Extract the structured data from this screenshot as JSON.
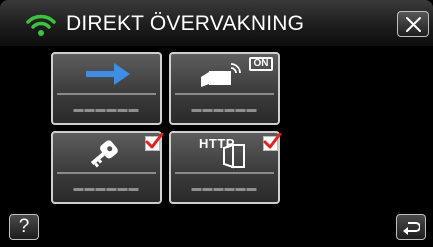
{
  "header": {
    "title": "DIREKT ÖVERVAKNING",
    "status_icon": "wifi-icon",
    "close_icon": "close-icon"
  },
  "tiles": [
    {
      "name": "network-tile",
      "icon": "arrow-right-icon",
      "label": "▬▬▬▬▬▬",
      "checked": false
    },
    {
      "name": "camera-on-tile",
      "icon": "video-camera-on-icon",
      "badge": "ON",
      "label": "▬▬▬▬▬▬",
      "checked": false
    },
    {
      "name": "security-key-tile",
      "icon": "key-icon",
      "label": "▬▬▬▬▬▬",
      "checked": true
    },
    {
      "name": "http-tile",
      "icon": "http-door-icon",
      "badge": "HTTP",
      "label": "▬▬▬▬▬▬",
      "checked": true
    }
  ],
  "footer": {
    "help_label": "?",
    "back_icon": "return-arrow-icon"
  },
  "colors": {
    "wifi": "#3dc23d",
    "arrow": "#3f8ee6",
    "check": "#e0231f",
    "tile_border": "#cfcfcf"
  }
}
